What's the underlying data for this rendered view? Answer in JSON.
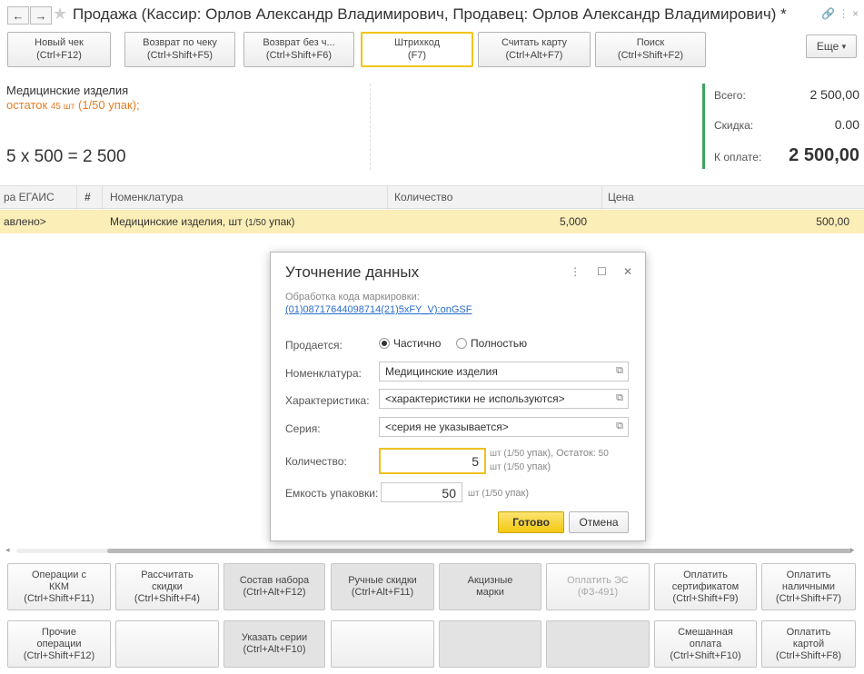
{
  "window": {
    "title": "Продажа (Кассир: Орлов Александр Владимирович, Продавец: Орлов Александр Владимирович)",
    "title_suffix": "*",
    "back_icon": "arrow-left-icon",
    "forward_icon": "arrow-right-icon",
    "favorite_icon": "star-icon",
    "header_icons": "🔗 ⋮ ×"
  },
  "toolbar": {
    "buttons": [
      {
        "label": "Новый чек",
        "shortcut": "(Ctrl+F12)"
      },
      {
        "label": "Возврат по чеку",
        "shortcut": "(Ctrl+Shift+F5)"
      },
      {
        "label": "Возврат без ч...",
        "shortcut": "(Ctrl+Shift+F6)"
      },
      {
        "label": "Штрихкод",
        "shortcut": "(F7)"
      },
      {
        "label": "Считать карту",
        "shortcut": "(Ctrl+Alt+F7)"
      },
      {
        "label": "Поиск",
        "shortcut": "(Ctrl+Shift+F2)"
      }
    ],
    "more_label": "Еще",
    "more_arrow": "▾"
  },
  "info": {
    "product_name": "Медицинские изделия",
    "stock_label": "остаток",
    "stock_qty": "45 шт",
    "stock_pack": "(1/50",
    "stock_pack_unit": "упак);",
    "formula": "5 x 500 = 2 500"
  },
  "totals": {
    "total_label": "Всего:",
    "total_value": "2 500,00",
    "discount_label": "Скидка:",
    "discount_value": "0.00",
    "payable_label": "К оплате:",
    "payable_value": "2 500,00",
    "accent_color": "#3aa55b"
  },
  "table": {
    "headers": [
      "ра ЕГАИС",
      "#",
      "Номенклатура",
      "Количество",
      "Цена"
    ],
    "rows": [
      {
        "egais": "авлено>",
        "nomenclature": "Медицинские изделия, шт",
        "pack": "(1/50",
        "pack_unit": "упак)",
        "quantity": "5,000",
        "price": "500,00"
      }
    ]
  },
  "dialog": {
    "title": "Уточнение данных",
    "icons": [
      "⋮",
      "☐",
      "✕"
    ],
    "note": "Обработка кода маркировки:",
    "code": "(01)08717644098714(21)5xFY_V):onGSF",
    "sold_label": "Продается:",
    "sold_option_partial": "Частично",
    "sold_option_full": "Полностью",
    "sold_selected": "Частично",
    "nomenclature_label": "Номенклатура:",
    "nomenclature_value": "Медицинские изделия",
    "characteristic_label": "Характеристика:",
    "characteristic_value": "<характеристики не используются>",
    "series_label": "Серия:",
    "series_value": "<серия не указывается>",
    "quantity_label": "Количество:",
    "quantity_value": "5",
    "quantity_note_1": "шт",
    "quantity_note_1b": "(1/50",
    "quantity_note_1c": "упак), Остаток:",
    "quantity_note_1d": "50",
    "quantity_note_2": "шт",
    "quantity_note_2b": "(1/50",
    "quantity_note_2c": "упак)",
    "capacity_label": "Емкость упаковки:",
    "capacity_value": "50",
    "capacity_note": "шт",
    "capacity_note_b": "(1/50",
    "capacity_note_c": "упак)",
    "ok_label": "Готово",
    "cancel_label": "Отмена"
  },
  "bottom": {
    "row1": [
      {
        "line1": "Операции с",
        "line2": "ККМ",
        "line3": "(Ctrl+Shift+F11)"
      },
      {
        "line1": "Рассчитать",
        "line2": "скидки",
        "line3": "(Ctrl+Shift+F4)"
      },
      {
        "line1": "Состав набора",
        "line2": "(Ctrl+Alt+F12)",
        "line3": ""
      },
      {
        "line1": "Ручные скидки",
        "line2": "(Ctrl+Alt+F11)",
        "line3": ""
      },
      {
        "line1": "Акцизные",
        "line2": "марки",
        "line3": ""
      },
      {
        "line1": "Оплатить ЭС",
        "line2": "(ФЗ-491)",
        "line3": ""
      },
      {
        "line1": "Оплатить",
        "line2": "сертификатом",
        "line3": "(Ctrl+Shift+F9)"
      },
      {
        "line1": "Оплатить",
        "line2": "наличными",
        "line3": "(Ctrl+Shift+F7)"
      }
    ],
    "row2": [
      {
        "line1": "Прочие",
        "line2": "операции",
        "line3": "(Ctrl+Shift+F12)"
      },
      {
        "line1": "",
        "line2": "",
        "line3": ""
      },
      {
        "line1": "Указать серии",
        "line2": "(Ctrl+Alt+F10)",
        "line3": ""
      },
      {
        "line1": "",
        "line2": "",
        "line3": ""
      },
      {
        "line1": "",
        "line2": "",
        "line3": ""
      },
      {
        "line1": "",
        "line2": "",
        "line3": ""
      },
      {
        "line1": "Смешанная",
        "line2": "оплата",
        "line3": "(Ctrl+Shift+F10)"
      },
      {
        "line1": "Оплатить",
        "line2": "картой",
        "line3": "(Ctrl+Shift+F8)"
      }
    ]
  }
}
